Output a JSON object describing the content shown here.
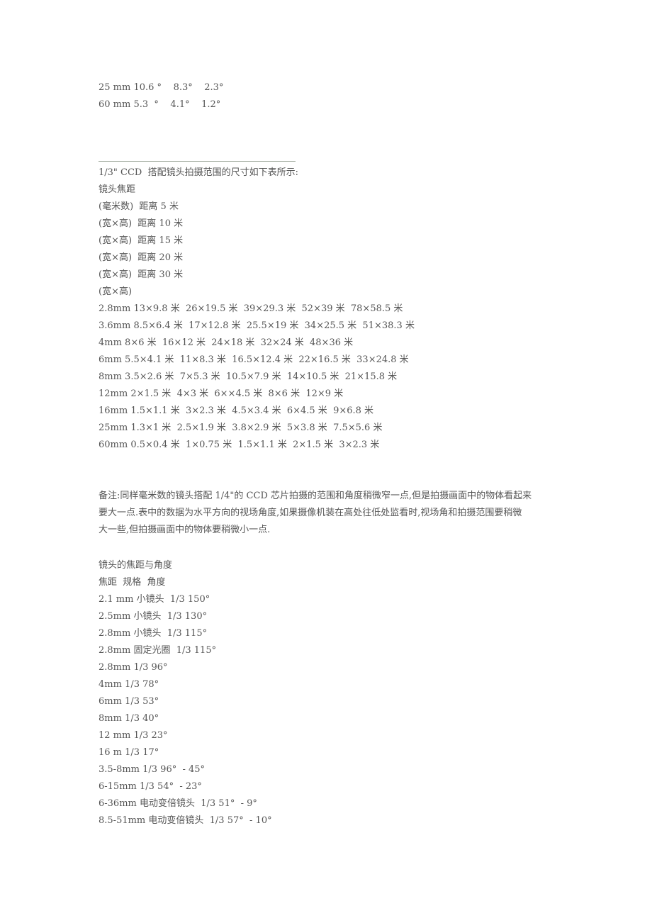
{
  "top_angle_rows": [
    "25 mm 10.6 °    8.3°    2.3°",
    "60 mm 5.3  °    4.1°    1.2°"
  ],
  "ccd_section": {
    "title": "1/3\" CCD  搭配镜头拍摄范围的尺寸如下表所示:",
    "header_lines": [
      "镜头焦距",
      "(毫米数)  距离 5 米",
      "(宽×高)  距离 10 米",
      "(宽×高)  距离 15 米",
      "(宽×高)  距离 20 米",
      "(宽×高)  距离 30 米",
      "(宽×高)"
    ],
    "rows": [
      "2.8mm 13×9.8 米  26×19.5 米  39×29.3 米  52×39 米  78×58.5 米",
      "3.6mm 8.5×6.4 米  17×12.8 米  25.5×19 米  34×25.5 米  51×38.3 米",
      "4mm 8×6 米  16×12 米  24×18 米  32×24 米  48×36 米",
      "6mm 5.5×4.1 米  11×8.3 米  16.5×12.4 米  22×16.5 米  33×24.8 米",
      "8mm 3.5×2.6 米  7×5.3 米  10.5×7.9 米  14×10.5 米  21×15.8 米",
      "12mm 2×1.5 米  4×3 米  6××4.5 米  8×6 米  12×9 米",
      "16mm 1.5×1.1 米  3×2.3 米  4.5×3.4 米  6×4.5 米  9×6.8 米",
      "25mm 1.3×1 米  2.5×1.9 米  3.8×2.9 米  5×3.8 米  7.5×5.6 米",
      "60mm 0.5×0.4 米  1×0.75 米  1.5×1.1 米  2×1.5 米  3×2.3 米"
    ]
  },
  "note": {
    "lines": [
      "备注:同样毫米数的镜头搭配 1/4\"的 CCD 芯片拍摄的范围和角度稍微窄一点,但是拍摄画面中的物体看起来",
      "要大一点.表中的数据为水平方向的视场角度,如果摄像机装在高处往低处监看时,视场角和拍摄范围要稍微",
      "大一些,但拍摄画面中的物体要稍微小一点."
    ]
  },
  "angles_section": {
    "title": "镜头的焦距与角度",
    "header": "焦距  规格  角度",
    "rows": [
      "2.1 mm 小镜头  1/3 150°",
      "2.5mm 小镜头  1/3 130°",
      "2.8mm 小镜头  1/3 115°",
      "2.8mm 固定光圈  1/3 115°",
      "2.8mm 1/3 96°",
      "4mm 1/3 78°",
      "6mm 1/3 53°",
      "8mm 1/3 40°",
      "12 mm 1/3 23°",
      "16 m 1/3 17°",
      "3.5-8mm 1/3 96°  - 45°",
      "6-15mm 1/3 54°  - 23°",
      "6-36mm 电动变倍镜头  1/3 51°  - 9°",
      "8.5-51mm 电动变倍镜头  1/3 57°  - 10°"
    ]
  }
}
